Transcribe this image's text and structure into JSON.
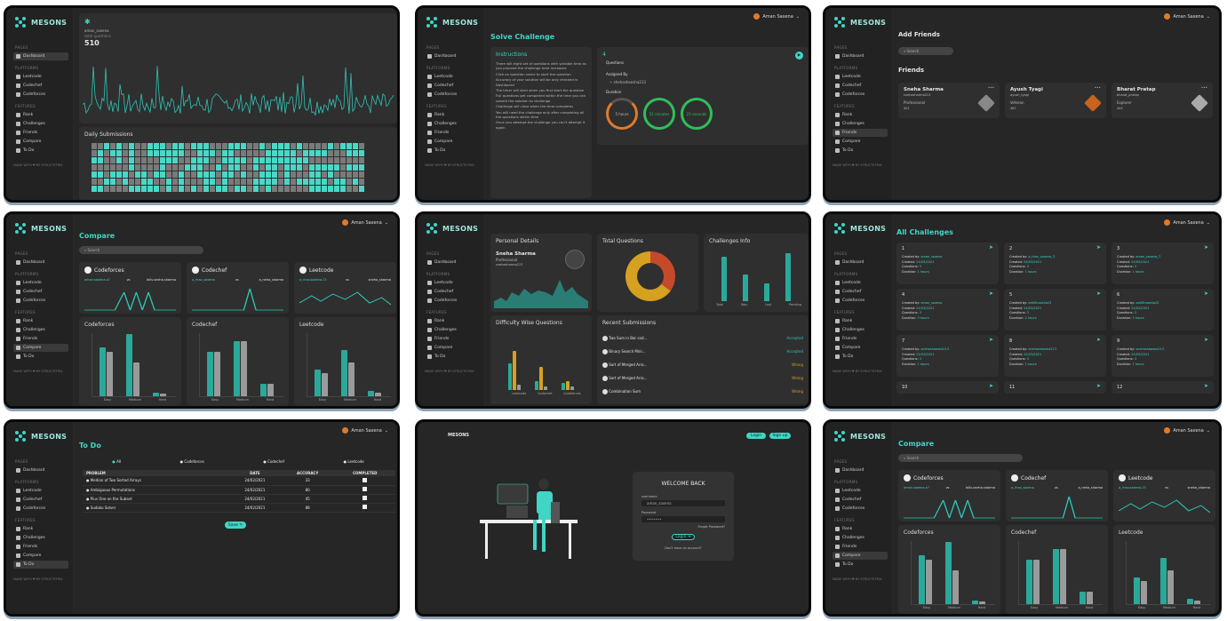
{
  "app": {
    "brand": "MESONS",
    "user_name": "Aman Saxena",
    "footer_note": "MADE WITH ❤ BY STRUCTSTRIX"
  },
  "sidebar": {
    "sections": [
      {
        "heading": "PAGES",
        "items": [
          "Dashboard"
        ]
      },
      {
        "heading": "PLATFORMS",
        "items": [
          "Leetcode",
          "Codechef",
          "Codeforces"
        ]
      },
      {
        "heading": "FEATURES",
        "items": [
          "Rank",
          "Challenges",
          "Friends",
          "Compare",
          "To Do"
        ]
      }
    ]
  },
  "dashboard": {
    "username": "aman_saxena",
    "subtitle": "total questions",
    "total": "510",
    "daily_title": "Daily Submissions"
  },
  "solve": {
    "title": "Solve Challenge",
    "instructions_title": "Instructions",
    "instructions": [
      "There will eight set of questions with variable time as you proceed the challenge time increases",
      "Click on question name to start the question",
      "Accuracy of your solution will be only checked in Dashboard",
      "The timer will start when you first start the question",
      "Full questions get completed within the time you can submit the solution to challenge",
      "Challenge will close when the time completes",
      "You will need the challenge only after completing all the questions within time",
      "Once you attempt the challenge you can't attempt it again"
    ],
    "challenge_no": "4",
    "questions_label": "Questions",
    "assigned_label": "Assigned By",
    "assigned_value": "~ shehashaesha213",
    "duration_label": "Duration",
    "rings": [
      "5 hours",
      "51 minutes",
      "23 seconds"
    ]
  },
  "friends": {
    "add_title": "Add Friends",
    "search_placeholder": "Search",
    "list_title": "Friends",
    "cards": [
      {
        "name": "Sneha Sharma",
        "handle": "snehasharma213",
        "rank": "Professional",
        "score": "401"
      },
      {
        "name": "Ayush Tyagi",
        "handle": "ayush_tyagi",
        "rank": "Veteran",
        "score": "487"
      },
      {
        "name": "Bharat Pratap",
        "handle": "bharat_pratap",
        "rank": "Explorer",
        "score": "444"
      }
    ]
  },
  "compare": {
    "title": "Compare",
    "search_placeholder": "Search",
    "platforms": [
      {
        "name": "Codeforces",
        "left": "aman.saxena.a7",
        "right": "bills.sneha.sharma"
      },
      {
        "name": "Codechef",
        "left": "a_rhav_saxena",
        "right": "a_neha_sharma"
      },
      {
        "name": "Leetcode",
        "left": "a_rhav.saxena.13",
        "right": "sneha_sharma"
      }
    ],
    "vs": "vs",
    "bar_labels": [
      "Easy",
      "Medium",
      "Hard"
    ]
  },
  "profile": {
    "personal_title": "Personal Details",
    "name": "Sneha Sharma",
    "rank": "Professional",
    "handle": "snehasharma213",
    "total_title": "Total Questions",
    "challenges_title": "Challenges Info",
    "challenges_axis": [
      "Total",
      "Won",
      "Lost",
      "Pending"
    ],
    "difficulty_title": "Difficulty Wise Questions",
    "difficulty_axis": [
      "Leetcode",
      "Codechef",
      "Codeforces"
    ],
    "recent_title": "Recent Submissions",
    "recent": [
      {
        "q": "Two Sum in Bar cod...",
        "status": "Accepted"
      },
      {
        "q": "Binary Search Mini...",
        "status": "Accepted"
      },
      {
        "q": "Sort of Merged Arra...",
        "status": "Wrong"
      },
      {
        "q": "Sort of Merged Arra...",
        "status": "Wrong"
      },
      {
        "q": "Combination Sum",
        "status": "Wrong"
      }
    ]
  },
  "challenges": {
    "title": "All Challenges",
    "labels": {
      "created_by": "Created by",
      "created": "Created",
      "questions": "Questions",
      "duration": "Duration"
    },
    "items": [
      {
        "no": "1",
        "by": "aman_saxena",
        "date": "24/03/2021",
        "q": "3",
        "d": "1 hours"
      },
      {
        "no": "2",
        "by": "a_rhav_saxena_3",
        "date": "24/03/2021",
        "q": "3",
        "d": "1 hours"
      },
      {
        "no": "3",
        "by": "aman_saxena_7",
        "date": "24/03/2021",
        "q": "3",
        "d": "1 hours"
      },
      {
        "no": "4",
        "by": "aman_saxena",
        "date": "24/03/2021",
        "q": "3",
        "d": "3 hours"
      },
      {
        "no": "5",
        "by": "aditShaasha23",
        "date": "24/03/2021",
        "q": "3",
        "d": "2 hours"
      },
      {
        "no": "6",
        "by": "aditShaasha23",
        "date": "24/03/2021",
        "q": "3",
        "d": "3 hours"
      },
      {
        "no": "7",
        "by": "snehashaasha213",
        "date": "24/03/2021",
        "q": "3",
        "d": "1 hours"
      },
      {
        "no": "8",
        "by": "snehashaasha213",
        "date": "24/03/2021",
        "q": "3",
        "d": "1 hours"
      },
      {
        "no": "9",
        "by": "snehashaasha213",
        "date": "24/03/2021",
        "q": "3",
        "d": "1 hours"
      },
      {
        "no": "10"
      },
      {
        "no": "11"
      },
      {
        "no": "12"
      }
    ]
  },
  "todo": {
    "title": "To Do",
    "filters": [
      "All",
      "Codeforces",
      "Codechef",
      "Leetcode"
    ],
    "headers": [
      "PROBLEM",
      "DATE",
      "ACCURACY",
      "COMPLETED"
    ],
    "rows": [
      {
        "problem": "Median of Two Sorted Arrays",
        "date": "24/02/2021",
        "acc": "33"
      },
      {
        "problem": "Ambiguous Permutations",
        "date": "24/02/2021",
        "acc": "80"
      },
      {
        "problem": "Plus One on the Subset",
        "date": "24/02/2021",
        "acc": "45"
      },
      {
        "problem": "Sudoku Solver",
        "date": "24/02/2021",
        "acc": "88"
      }
    ],
    "save_label": "Save ✎"
  },
  "login": {
    "brand": "MESONS",
    "login_btn": "Login",
    "signup_btn": "Sign up",
    "welcome": "WELCOME BACK",
    "user_label": "username",
    "user_value": "aman_saxena",
    "pass_label": "Password",
    "pass_value": "•••••••",
    "forgot": "Forgot Password?",
    "submit": "Login ➔",
    "signup_link": "Don't have an account?"
  },
  "colors": {
    "accent": "#3fd6c6",
    "bg": "#1b1b1b",
    "card": "#2f2f2f"
  }
}
